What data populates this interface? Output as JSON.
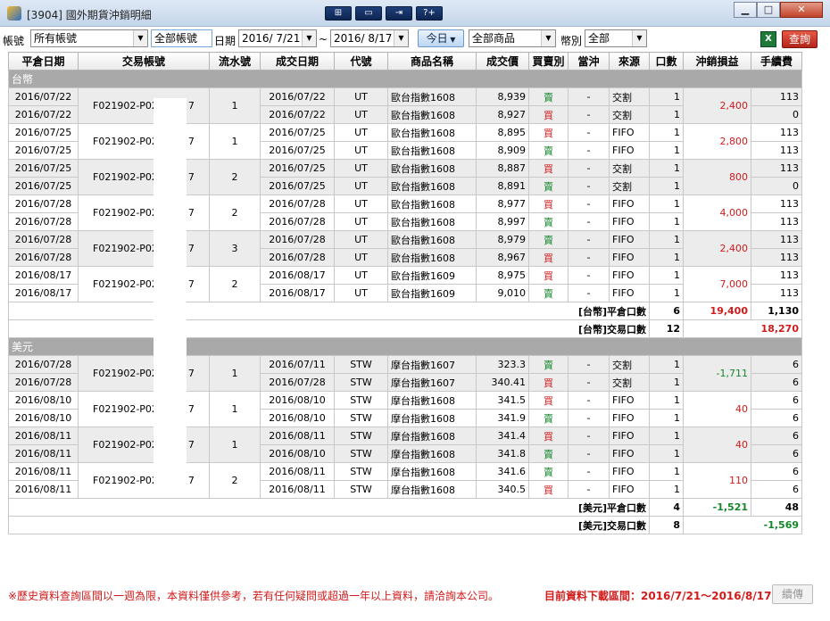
{
  "window": {
    "title": "[3904] 國外期貨沖銷明細",
    "buttons": [
      "⊞",
      "▭",
      "⇥",
      "?+"
    ],
    "controls": [
      "▁",
      "□",
      "✕"
    ]
  },
  "toolbar": {
    "account_label": "帳號",
    "account_value": "所有帳號",
    "account_type": "全部帳號",
    "date_label": "日期",
    "date_from": "2016/ 7/21",
    "tilde": "~",
    "date_to": "2016/ 8/17",
    "today_label": "今日",
    "product_value": "全部商品",
    "currency_label": "幣別",
    "currency_value": "全部",
    "excel_icon": "excel-icon",
    "query_label": "查詢"
  },
  "table": {
    "headers": [
      "平倉日期",
      "交易帳號",
      "流水號",
      "成交日期",
      "代號",
      "商品名稱",
      "成交價",
      "買賣別",
      "當沖",
      "來源",
      "口數",
      "沖銷損益",
      "手續費"
    ],
    "groups": [
      {
        "name": "台幣",
        "pairs": [
          {
            "close": [
              "2016/07/22",
              "2016/07/22"
            ],
            "account": "F021902-P02-",
            "acct_suffix": "7",
            "serial": "1",
            "rows": [
              {
                "trade_date": "2016/07/22",
                "code": "UT",
                "product": "歐台指數1608",
                "price": "8,939",
                "side": "賣",
                "daytrade": "-",
                "source": "交割",
                "qty": "1",
                "fee": "113"
              },
              {
                "trade_date": "2016/07/22",
                "code": "UT",
                "product": "歐台指數1608",
                "price": "8,927",
                "side": "買",
                "daytrade": "-",
                "source": "交割",
                "qty": "1",
                "fee": "0"
              }
            ],
            "pnl": "2,400"
          },
          {
            "close": [
              "2016/07/25",
              "2016/07/25"
            ],
            "account": "F021902-P02-",
            "acct_suffix": "7",
            "serial": "1",
            "rows": [
              {
                "trade_date": "2016/07/25",
                "code": "UT",
                "product": "歐台指數1608",
                "price": "8,895",
                "side": "買",
                "daytrade": "-",
                "source": "FIFO",
                "qty": "1",
                "fee": "113"
              },
              {
                "trade_date": "2016/07/25",
                "code": "UT",
                "product": "歐台指數1608",
                "price": "8,909",
                "side": "賣",
                "daytrade": "-",
                "source": "FIFO",
                "qty": "1",
                "fee": "113"
              }
            ],
            "pnl": "2,800"
          },
          {
            "close": [
              "2016/07/25",
              "2016/07/25"
            ],
            "account": "F021902-P02-",
            "acct_suffix": "7",
            "serial": "2",
            "rows": [
              {
                "trade_date": "2016/07/25",
                "code": "UT",
                "product": "歐台指數1608",
                "price": "8,887",
                "side": "買",
                "daytrade": "-",
                "source": "交割",
                "qty": "1",
                "fee": "113"
              },
              {
                "trade_date": "2016/07/25",
                "code": "UT",
                "product": "歐台指數1608",
                "price": "8,891",
                "side": "賣",
                "daytrade": "-",
                "source": "交割",
                "qty": "1",
                "fee": "0"
              }
            ],
            "pnl": "800"
          },
          {
            "close": [
              "2016/07/28",
              "2016/07/28"
            ],
            "account": "F021902-P02-",
            "acct_suffix": "7",
            "serial": "2",
            "rows": [
              {
                "trade_date": "2016/07/28",
                "code": "UT",
                "product": "歐台指數1608",
                "price": "8,977",
                "side": "買",
                "daytrade": "-",
                "source": "FIFO",
                "qty": "1",
                "fee": "113"
              },
              {
                "trade_date": "2016/07/28",
                "code": "UT",
                "product": "歐台指數1608",
                "price": "8,997",
                "side": "賣",
                "daytrade": "-",
                "source": "FIFO",
                "qty": "1",
                "fee": "113"
              }
            ],
            "pnl": "4,000"
          },
          {
            "close": [
              "2016/07/28",
              "2016/07/28"
            ],
            "account": "F021902-P02-",
            "acct_suffix": "7",
            "serial": "3",
            "rows": [
              {
                "trade_date": "2016/07/28",
                "code": "UT",
                "product": "歐台指數1608",
                "price": "8,979",
                "side": "賣",
                "daytrade": "-",
                "source": "FIFO",
                "qty": "1",
                "fee": "113"
              },
              {
                "trade_date": "2016/07/28",
                "code": "UT",
                "product": "歐台指數1608",
                "price": "8,967",
                "side": "買",
                "daytrade": "-",
                "source": "FIFO",
                "qty": "1",
                "fee": "113"
              }
            ],
            "pnl": "2,400"
          },
          {
            "close": [
              "2016/08/17",
              "2016/08/17"
            ],
            "account": "F021902-P02-",
            "acct_suffix": "7",
            "serial": "2",
            "rows": [
              {
                "trade_date": "2016/08/17",
                "code": "UT",
                "product": "歐台指數1609",
                "price": "8,975",
                "side": "買",
                "daytrade": "-",
                "source": "FIFO",
                "qty": "1",
                "fee": "113"
              },
              {
                "trade_date": "2016/08/17",
                "code": "UT",
                "product": "歐台指數1609",
                "price": "9,010",
                "side": "賣",
                "daytrade": "-",
                "source": "FIFO",
                "qty": "1",
                "fee": "113"
              }
            ],
            "pnl": "7,000"
          }
        ],
        "summary_close": {
          "label": "[台幣]平倉口數",
          "qty": "6",
          "pnl": "19,400",
          "fee": "1,130"
        },
        "summary_trade": {
          "label": "[台幣]交易口數",
          "qty": "12",
          "total": "18,270"
        }
      },
      {
        "name": "美元",
        "pairs": [
          {
            "close": [
              "2016/07/28",
              "2016/07/28"
            ],
            "account": "F021902-P02-",
            "acct_suffix": "7",
            "serial": "1",
            "rows": [
              {
                "trade_date": "2016/07/11",
                "code": "STW",
                "product": "摩台指數1607",
                "price": "323.3",
                "side": "賣",
                "daytrade": "-",
                "source": "交割",
                "qty": "1",
                "fee": "6"
              },
              {
                "trade_date": "2016/07/28",
                "code": "STW",
                "product": "摩台指數1607",
                "price": "340.41",
                "side": "買",
                "daytrade": "-",
                "source": "交割",
                "qty": "1",
                "fee": "6"
              }
            ],
            "pnl": "-1,711"
          },
          {
            "close": [
              "2016/08/10",
              "2016/08/10"
            ],
            "account": "F021902-P02-",
            "acct_suffix": "7",
            "serial": "1",
            "rows": [
              {
                "trade_date": "2016/08/10",
                "code": "STW",
                "product": "摩台指數1608",
                "price": "341.5",
                "side": "買",
                "daytrade": "-",
                "source": "FIFO",
                "qty": "1",
                "fee": "6"
              },
              {
                "trade_date": "2016/08/10",
                "code": "STW",
                "product": "摩台指數1608",
                "price": "341.9",
                "side": "賣",
                "daytrade": "-",
                "source": "FIFO",
                "qty": "1",
                "fee": "6"
              }
            ],
            "pnl": "40"
          },
          {
            "close": [
              "2016/08/11",
              "2016/08/11"
            ],
            "account": "F021902-P02-",
            "acct_suffix": "7",
            "serial": "1",
            "rows": [
              {
                "trade_date": "2016/08/11",
                "code": "STW",
                "product": "摩台指數1608",
                "price": "341.4",
                "side": "買",
                "daytrade": "-",
                "source": "FIFO",
                "qty": "1",
                "fee": "6"
              },
              {
                "trade_date": "2016/08/10",
                "code": "STW",
                "product": "摩台指數1608",
                "price": "341.8",
                "side": "賣",
                "daytrade": "-",
                "source": "FIFO",
                "qty": "1",
                "fee": "6"
              }
            ],
            "pnl": "40"
          },
          {
            "close": [
              "2016/08/11",
              "2016/08/11"
            ],
            "account": "F021902-P02-",
            "acct_suffix": "7",
            "serial": "2",
            "rows": [
              {
                "trade_date": "2016/08/11",
                "code": "STW",
                "product": "摩台指數1608",
                "price": "341.6",
                "side": "賣",
                "daytrade": "-",
                "source": "FIFO",
                "qty": "1",
                "fee": "6"
              },
              {
                "trade_date": "2016/08/11",
                "code": "STW",
                "product": "摩台指數1608",
                "price": "340.5",
                "side": "買",
                "daytrade": "-",
                "source": "FIFO",
                "qty": "1",
                "fee": "6"
              }
            ],
            "pnl": "110"
          }
        ],
        "summary_close": {
          "label": "[美元]平倉口數",
          "qty": "4",
          "pnl": "-1,521",
          "fee": "48"
        },
        "summary_trade": {
          "label": "[美元]交易口數",
          "qty": "8",
          "total": "-1,569"
        }
      }
    ]
  },
  "footer": {
    "note": "※歷史資料查詢區間以一週為限，本資料僅供參考，若有任何疑問或超過一年以上資料，請洽詢本公司。",
    "range": "目前資料下載區間：2016/7/21～2016/8/17",
    "resume_label": "續傳"
  },
  "colors": {
    "buy": "#d21b1b",
    "sell": "#15882c",
    "group_bar": "#a9a9a9",
    "note": "#d21b1b"
  }
}
